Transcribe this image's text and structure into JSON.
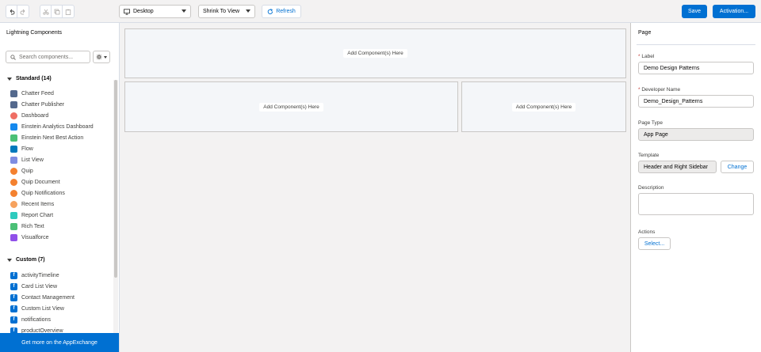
{
  "toolbar": {
    "device_select": "Desktop",
    "view_select": "Shrink To View",
    "refresh_label": "Refresh",
    "save_label": "Save",
    "activation_label": "Activation..."
  },
  "left_panel": {
    "title": "Lightning Components",
    "search_placeholder": "Search components...",
    "standard_header": "Standard (14)",
    "standard_items": [
      {
        "label": "Chatter Feed",
        "icon": "chatter-feed-icon",
        "color": "#54698d"
      },
      {
        "label": "Chatter Publisher",
        "icon": "chatter-publisher-icon",
        "color": "#54698d"
      },
      {
        "label": "Dashboard",
        "icon": "dashboard-icon",
        "color": "#ef6e64"
      },
      {
        "label": "Einstein Analytics Dashboard",
        "icon": "einstein-analytics-icon",
        "color": "#1589ee"
      },
      {
        "label": "Einstein Next Best Action",
        "icon": "einstein-nba-icon",
        "color": "#4bc076"
      },
      {
        "label": "Flow",
        "icon": "flow-icon",
        "color": "#0079bc"
      },
      {
        "label": "List View",
        "icon": "list-view-icon",
        "color": "#7f8de1"
      },
      {
        "label": "Quip",
        "icon": "quip-icon",
        "color": "#f4812f"
      },
      {
        "label": "Quip Document",
        "icon": "quip-document-icon",
        "color": "#f4812f"
      },
      {
        "label": "Quip Notifications",
        "icon": "quip-notifications-icon",
        "color": "#f4812f"
      },
      {
        "label": "Recent Items",
        "icon": "recent-items-icon",
        "color": "#f6a25e"
      },
      {
        "label": "Report Chart",
        "icon": "report-chart-icon",
        "color": "#2ecbbe"
      },
      {
        "label": "Rich Text",
        "icon": "rich-text-icon",
        "color": "#4bc076"
      },
      {
        "label": "Visualforce",
        "icon": "visualforce-icon",
        "color": "#9050e9"
      }
    ],
    "custom_header": "Custom (7)",
    "custom_items": [
      {
        "label": "activityTimeline",
        "icon": "custom-component-icon",
        "color": "#0070d2"
      },
      {
        "label": "Card List View",
        "icon": "custom-component-icon",
        "color": "#0070d2"
      },
      {
        "label": "Contact Management",
        "icon": "custom-component-icon",
        "color": "#0070d2"
      },
      {
        "label": "Custom List View",
        "icon": "custom-component-icon",
        "color": "#0070d2"
      },
      {
        "label": "notifications",
        "icon": "custom-component-icon",
        "color": "#0070d2"
      },
      {
        "label": "productOverview",
        "icon": "custom-component-icon",
        "color": "#0070d2"
      }
    ],
    "appexchange_label": "Get more on the AppExchange"
  },
  "canvas": {
    "header_region": "Add Component(s) Here",
    "main_region": "Add Component(s) Here",
    "sidebar_region": "Add Component(s) Here"
  },
  "right_panel": {
    "title": "Page",
    "label_field_label": "Label",
    "label_value": "Demo Design Patterns",
    "dev_name_label": "Developer Name",
    "dev_name_value": "Demo_Design_Patterns",
    "page_type_label": "Page Type",
    "page_type_value": "App Page",
    "template_label": "Template",
    "template_value": "Header and Right Sidebar",
    "change_label": "Change",
    "description_label": "Description",
    "actions_label": "Actions",
    "select_label": "Select..."
  },
  "colors": {
    "brand": "#0070d2",
    "required": "#c23934"
  }
}
